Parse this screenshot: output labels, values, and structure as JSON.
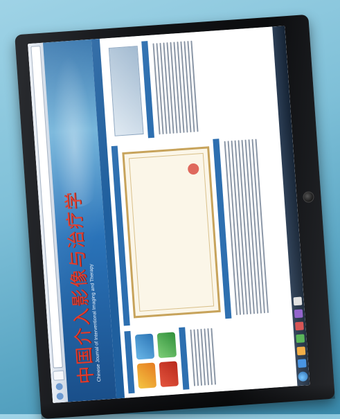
{
  "scene": {
    "subject": "monitor",
    "colors": {
      "background": "#7fc0d8",
      "bezel": "#121316",
      "banner": "#2a73b9",
      "logo_red": "#e23c2d",
      "taskbar": "#1c2b3e"
    }
  },
  "website": {
    "logo_text": "中国介入影像与治疗学",
    "logo_subtitle": "Chinese Journal of Interventional Imaging and Therapy"
  },
  "icons": {
    "power": "power-button-icon",
    "start": "windows-start-icon"
  }
}
